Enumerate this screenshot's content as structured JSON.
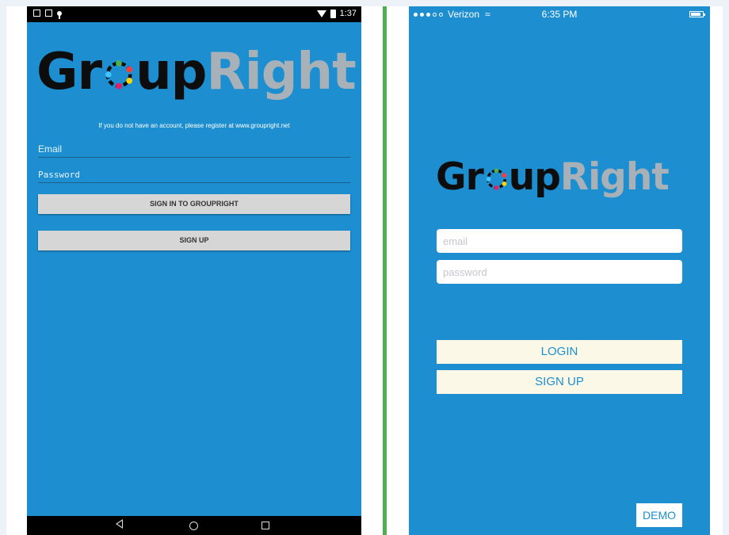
{
  "android": {
    "status_time": "1:37",
    "logo": {
      "part1": "Gr",
      "part2": "up",
      "part3": "Right"
    },
    "info_text": "If you do not have an account, please register at www.groupright.net",
    "email_placeholder": "Email",
    "password_placeholder": "Password",
    "signin_label": "SIGN IN TO GROUPRIGHT",
    "signup_label": "SIGN UP",
    "nav": {
      "back_icon": "back-triangle-icon",
      "home_icon": "home-circle-icon",
      "recents_icon": "recents-square-icon"
    }
  },
  "ios": {
    "carrier": "Verizon",
    "time": "6:35 PM",
    "logo": {
      "part1": "Gr",
      "part2": "up",
      "part3": "Right"
    },
    "email_placeholder": "email",
    "password_placeholder": "password",
    "login_label": "LOGIN",
    "signup_label": "SIGN UP",
    "demo_label": "DEMO"
  },
  "colors": {
    "app_background": "#1d8fd1",
    "logo_dark": "#0d0d0d",
    "logo_light": "#a9b1b8",
    "divider": "#4caf50",
    "ios_button": "#fbf8e8",
    "android_button": "#d6d6d6"
  }
}
